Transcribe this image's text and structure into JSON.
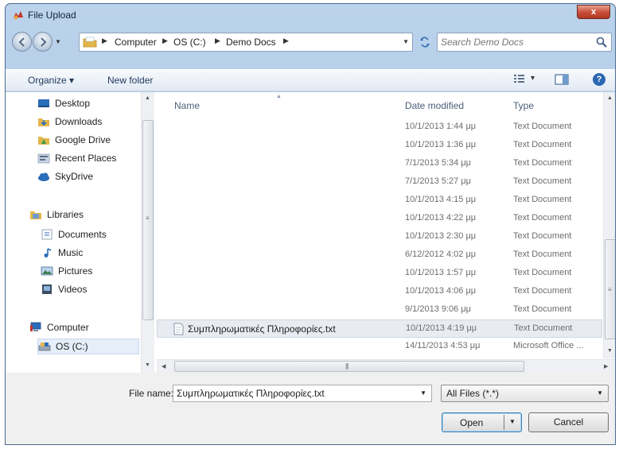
{
  "window": {
    "title": "File Upload",
    "close_glyph": "x"
  },
  "address": {
    "crumbs": [
      "Computer",
      "OS (C:)",
      "Demo Docs"
    ],
    "separator": "▶",
    "dropdown": "▼"
  },
  "search": {
    "placeholder": "Search Demo Docs"
  },
  "toolbar": {
    "organize": "Organize ▾",
    "new_folder": "New folder",
    "view": "▾",
    "help": "?"
  },
  "nav_pane": {
    "favorites": [
      "Desktop",
      "Downloads",
      "Google Drive",
      "Recent Places",
      "SkyDrive"
    ],
    "libraries": {
      "label": "Libraries",
      "items": [
        "Documents",
        "Music",
        "Pictures",
        "Videos"
      ]
    },
    "computer": {
      "label": "Computer",
      "items": [
        "OS (C:)"
      ]
    }
  },
  "columns": {
    "name": "Name",
    "date": "Date modified",
    "type": "Type"
  },
  "files": [
    {
      "name": "",
      "date": "10/1/2013 1:44 μμ",
      "type": "Text Document"
    },
    {
      "name": "",
      "date": "10/1/2013 1:36 μμ",
      "type": "Text Document"
    },
    {
      "name": "",
      "date": "7/1/2013 5:34 μμ",
      "type": "Text Document"
    },
    {
      "name": "",
      "date": "7/1/2013 5:27 μμ",
      "type": "Text Document"
    },
    {
      "name": "",
      "date": "10/1/2013 4:15 μμ",
      "type": "Text Document"
    },
    {
      "name": "",
      "date": "10/1/2013 4:22 μμ",
      "type": "Text Document"
    },
    {
      "name": "",
      "date": "10/1/2013 2:30 μμ",
      "type": "Text Document"
    },
    {
      "name": "",
      "date": "6/12/2012 4:02 μμ",
      "type": "Text Document"
    },
    {
      "name": "",
      "date": "10/1/2013 1:57 μμ",
      "type": "Text Document"
    },
    {
      "name": "",
      "date": "10/1/2013 4:06 μμ",
      "type": "Text Document"
    },
    {
      "name": "",
      "date": "9/1/2013 9:06 μμ",
      "type": "Text Document"
    },
    {
      "name": "Συμπληρωματικές Πληροφορίες.txt",
      "date": "10/1/2013 4:19 μμ",
      "type": "Text Document"
    },
    {
      "name": "",
      "date": "14/11/2013 4:53 μμ",
      "type": "Microsoft Office ..."
    }
  ],
  "selected_index": 11,
  "footer": {
    "file_name_label": "File name:",
    "file_name_value": "Συμπληρωματικές Πληροφορίες.txt",
    "filter": "All Files (*.*)",
    "open": "Open",
    "cancel": "Cancel"
  },
  "colors": {
    "titlebar": "#a9c4e4",
    "selection": "#e8ecf2",
    "close": "#c74c36"
  }
}
